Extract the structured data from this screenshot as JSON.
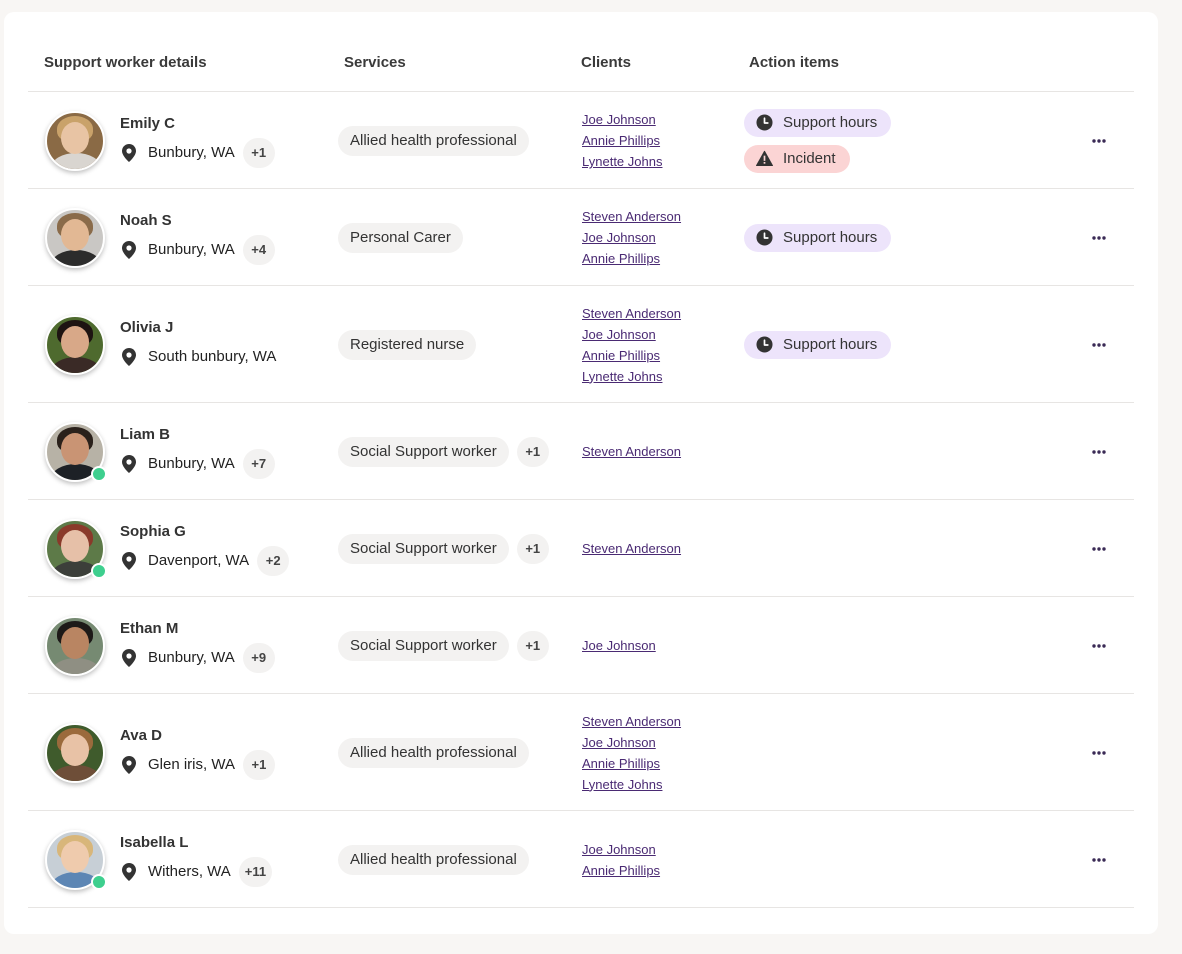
{
  "columns": {
    "worker": "Support worker details",
    "services": "Services",
    "clients": "Clients",
    "actions": "Action items"
  },
  "workers": [
    {
      "name": "Emily C",
      "location": "Bunbury, WA",
      "loc_extra": "+1",
      "service": "Allied health professional",
      "service_extra": "",
      "clients": [
        "Joe Johnson",
        "Annie Phillips",
        "Lynette Johns"
      ],
      "actions": [
        "Support hours",
        "Incident"
      ],
      "online": false
    },
    {
      "name": "Noah S",
      "location": "Bunbury, WA",
      "loc_extra": "+4",
      "service": "Personal Carer",
      "service_extra": "",
      "clients": [
        "Steven Anderson",
        "Joe Johnson",
        "Annie Phillips"
      ],
      "actions": [
        "Support hours"
      ],
      "online": false
    },
    {
      "name": "Olivia J",
      "location": "South bunbury, WA",
      "loc_extra": "",
      "service": "Registered nurse",
      "service_extra": "",
      "clients": [
        "Steven Anderson",
        "Joe Johnson",
        "Annie Phillips",
        "Lynette Johns"
      ],
      "actions": [
        "Support hours"
      ],
      "online": false
    },
    {
      "name": "Liam B",
      "location": "Bunbury, WA",
      "loc_extra": "+7",
      "service": "Social Support worker",
      "service_extra": "+1",
      "clients": [
        "Steven Anderson"
      ],
      "actions": [],
      "online": true
    },
    {
      "name": "Sophia G",
      "location": "Davenport, WA",
      "loc_extra": "+2",
      "service": "Social Support worker",
      "service_extra": "+1",
      "clients": [
        "Steven Anderson"
      ],
      "actions": [],
      "online": true
    },
    {
      "name": "Ethan M",
      "location": "Bunbury, WA",
      "loc_extra": "+9",
      "service": "Social Support worker",
      "service_extra": "+1",
      "clients": [
        "Joe Johnson"
      ],
      "actions": [],
      "online": false
    },
    {
      "name": "Ava D",
      "location": "Glen iris, WA",
      "loc_extra": "+1",
      "service": "Allied health professional",
      "service_extra": "",
      "clients": [
        "Steven Anderson",
        "Joe Johnson",
        "Annie Phillips",
        "Lynette Johns"
      ],
      "actions": [],
      "online": false
    },
    {
      "name": "Isabella L",
      "location": "Withers, WA",
      "loc_extra": "+11",
      "service": "Allied health professional",
      "service_extra": "",
      "clients": [
        "Joe Johnson",
        "Annie Phillips"
      ],
      "actions": [],
      "online": true
    }
  ],
  "icons": {
    "location": "map-pin-icon",
    "support_hours": "clock-icon",
    "incident": "warning-icon",
    "more": "more-horizontal-icon"
  },
  "colors": {
    "online": "#3ecf8e",
    "support_badge": "#ede4fb",
    "incident_badge": "#fbd4d4",
    "client_link": "#4a2a73"
  }
}
